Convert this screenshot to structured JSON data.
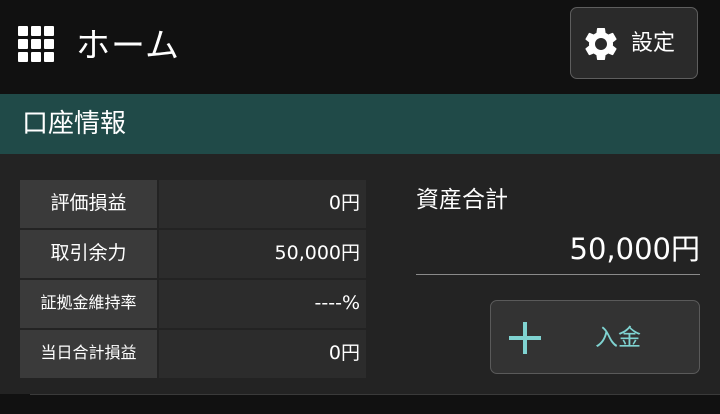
{
  "header": {
    "menu_icon": "grid-menu-icon",
    "title": "ホーム",
    "settings": {
      "icon": "gear-icon",
      "label": "設定"
    }
  },
  "section": {
    "title": "口座情報"
  },
  "account_info": {
    "rows": [
      {
        "label": "評価損益",
        "value": "0円"
      },
      {
        "label": "取引余力",
        "value": "50,000円"
      },
      {
        "label": "証拠金維持率",
        "value": "----%"
      },
      {
        "label": "当日合計損益",
        "value": "0円"
      }
    ]
  },
  "total_assets": {
    "label": "資産合計",
    "value": "50,000円"
  },
  "deposit": {
    "icon": "plus-icon",
    "label": "入金"
  },
  "colors": {
    "background": "#111111",
    "section_band": "#204a48",
    "panel": "#232323",
    "label_cell": "#3a3a3a",
    "value_cell": "#2c2c2c",
    "accent": "#7fd3d1"
  }
}
